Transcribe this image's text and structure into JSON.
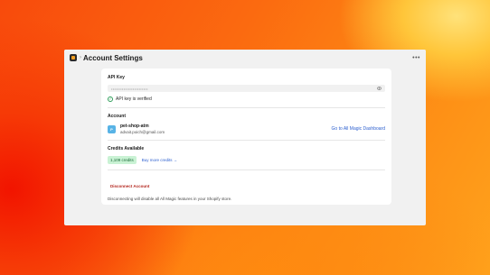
{
  "window": {
    "title": "Account Settings",
    "breadcrumb_separator": "›",
    "more_icon": "•••"
  },
  "api_key": {
    "section_title": "API Key",
    "masked_value": "••••••••••••••••••••••••",
    "status_text": "API key is verified",
    "status_icon": "check-circle-icon",
    "status_color": "#2f9e5a"
  },
  "account": {
    "section_title": "Account",
    "avatar_letter": "P",
    "avatar_color": "#58b3e6",
    "shop_name": "pet-shop-atm",
    "email": "advait.poich@gmail.com",
    "dashboard_link": "Go to All Magic Dashboard"
  },
  "credits": {
    "section_title": "Credits Available",
    "badge": "1,109 credits",
    "badge_color": "#c9f2d4",
    "buy_link": "Buy more credits →"
  },
  "disconnect": {
    "button_label": "Disconnect Account",
    "note": "Disconnecting will disable all All Magic features in your Shopify store."
  }
}
